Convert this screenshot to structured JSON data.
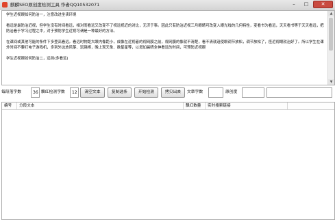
{
  "window": {
    "title": "麒麟SEO原创度检测工具 作者QQ10532071",
    "minimize_glyph": "–",
    "maximize_glyph": "□",
    "close_glyph": "✕",
    "app_icon": "app-icon",
    "accent_color": "#e0442a"
  },
  "text_area": {
    "paragraphs": [
      "学生近视眼如何防治一，注意改进坐读环境",
      "",
      "看远是最防治近视，但学生没有时间看远，相对而看远又改变不了视远视近的对比，无济于事。因此只有防治近视三月眼睛可改变入眼光线的几何特性，变看书为看远，天天看书等于天天看远，把防治看于学习过程之中，对于预防学生近视可谓是一种最好的方法。",
      "",
      "在课间或其他可能的条件下多登高看远。看远时物距大眼内像距小，成像在近视者的视网膜之前，视网膜的像就不清楚，看不清就迫使眼调节放松，调节放松了，痉近视眼就治好了。所以学生在课外时间不要打电子游戏机，多到外边放风筝、玩跳棒，晚上观天象、数星星等，以增加晨晴全神看远的时间，可预防近视眼",
      "",
      "学生近视眼如何防治二，远则(多看远)"
    ],
    "scroll_up_glyph": "▲",
    "scroll_down_glyph": "▼"
  },
  "controls": {
    "paragraph_chars_label": "每段落字数",
    "paragraph_chars_value": "36",
    "red_chars_label": "飘红检测字数",
    "red_chars_value": "12",
    "clear_text_button": "清空文本",
    "copy_results_button": "复制选条",
    "start_check_button": "开始检测",
    "copy_output_button": "拷贝出去",
    "article_chars_label": "文章字数",
    "article_chars_value": "",
    "originality_label": "原创度",
    "originality_value": "",
    "extra_value": ""
  },
  "results": {
    "columns": [
      "编号",
      "分段文本",
      "飘红数量",
      "实时搜索链接"
    ],
    "rows": []
  }
}
